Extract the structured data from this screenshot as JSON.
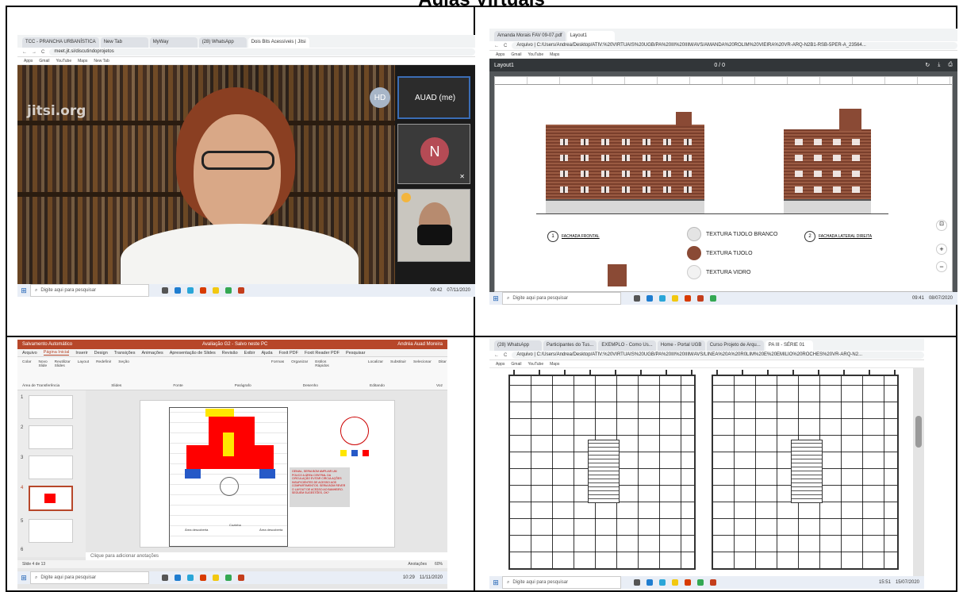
{
  "page_title": "Aulas Virtuais",
  "q1": {
    "tabs": [
      "TCC - PRANCHA URBANÍSTICA",
      "New Tab",
      "MyWay",
      "(28) WhatsApp",
      "Dois Bits Acessíveis | Jitsi"
    ],
    "url": "meet.jit.si/discutindoprojetos",
    "bookmarks": [
      "Apps",
      "Gmail",
      "YouTube",
      "Maps",
      "New Tab"
    ],
    "logo": "jitsi.org",
    "participants": [
      {
        "initials": "HD",
        "name": "AUAD (me)"
      },
      {
        "initials": "N",
        "name": ""
      }
    ],
    "search_placeholder": "Digite aqui para pesquisar",
    "clock_time": "09:42",
    "clock_date": "07/11/2020"
  },
  "q2": {
    "tabs": [
      "Amanda Morais FAV 09-07.pdf",
      "Layout1"
    ],
    "url": "Arquivo | C:/Users/Andrea/Desktop/ATIV.%20VIRTUAIS%20UGB/PA%20III%20IIIM/AVS/AMANDA%20ROLIM%20VIEIRA%20VR-ARQ-N2B1-RSB-5PER-A_23564...",
    "bookmarks": [
      "Apps",
      "Gmail",
      "YouTube",
      "Maps"
    ],
    "viewer_title": "Layout1",
    "page_counter": "0 / 0",
    "legend": [
      "TEXTURA TIJOLO BRANCO",
      "TEXTURA TIJOLO",
      "TEXTURA VIDRO"
    ],
    "fachada_1_num": "1",
    "fachada_1": "FACHADA FRONTAL",
    "fachada_2_num": "2",
    "fachada_2": "FACHADA LATERAL DIREITA",
    "search_placeholder": "Digite aqui para pesquisar",
    "clock_time": "09:41",
    "clock_date": "08/07/2020"
  },
  "q3": {
    "title_bar": "Avaliação G2 - Salvo neste PC",
    "autosave": "Salvamento Automático",
    "user": "Andréa Auad Moreira",
    "menu": [
      "Arquivo",
      "Página Inicial",
      "Inserir",
      "Design",
      "Transições",
      "Animações",
      "Apresentação de Slides",
      "Revisão",
      "Exibir",
      "Ajuda",
      "Foxit PDF",
      "Foxit Reader PDF",
      "Pesquisar"
    ],
    "ribbon_groups": [
      "Área de Transferência",
      "Slides",
      "Fonte",
      "Parágrafo",
      "Desenho",
      "Editando",
      "Voz"
    ],
    "ribbon_buttons": [
      "Colar",
      "Novo Slide",
      "Reutilizar Slides",
      "Layout",
      "Redefinir",
      "Seção",
      "Formas",
      "Organizar",
      "Estilos Rápidos",
      "Localizar",
      "Substituir",
      "Selecionar",
      "Ditar"
    ],
    "slide_numbers": [
      "1",
      "2",
      "3",
      "4",
      "5",
      "6"
    ],
    "comment": "GENIAL, SERIA BOM AMPLIAR UM POUCO A ÁREA CENTRAL DA CIRCULAÇÃO EVITAR CIRCULAÇÕES INSUFICIENTES DE ACESSO AOS COMPARTIMENTOS. SERIA BOM REVER O LAYOUT DE ACESSO AO BANHEIRO. SEGUEM SUGESTÕES, OK?",
    "labels": [
      "Área descoberta",
      "Cozinha",
      "Área descoberta"
    ],
    "notes_placeholder": "Clique para adicionar anotações",
    "status": "Slide 4 de 13",
    "anotacoes": "Anotações",
    "zoom": "60%",
    "search_placeholder": "Digite aqui para pesquisar",
    "clock_time": "10:29",
    "clock_date": "11/11/2020"
  },
  "q4": {
    "tabs": [
      "(28) WhatsApp",
      "Participantes do Tus...",
      "EXEMPLO - Como Us...",
      "Home - Portal UGB",
      "Curso Projeto de Arqu...",
      "PA III - SÉRIE 01"
    ],
    "url": "Arquivo | C:/Users/Andrea/Desktop/ATIV.%20VIRTUAIS%20UGB/PA%20III%20IIIM/AVS/LINEA%20A%20R0LIM%20E%20EMILIO%20ROCHES%20VR-ARQ-N2...",
    "bookmarks": [
      "Apps",
      "Gmail",
      "YouTube",
      "Maps"
    ],
    "search_placeholder": "Digite aqui para pesquisar",
    "clock_time": "15:51",
    "clock_date": "15/07/2020"
  },
  "colors": {
    "brick": "#8a4a35",
    "ppt_red": "#b7472a",
    "jitsi_dark": "#1d1d1d",
    "blueprint_line": "#333333",
    "plan_red": "#ff0000",
    "plan_yellow": "#ffe600",
    "plan_blue": "#2659c7"
  }
}
